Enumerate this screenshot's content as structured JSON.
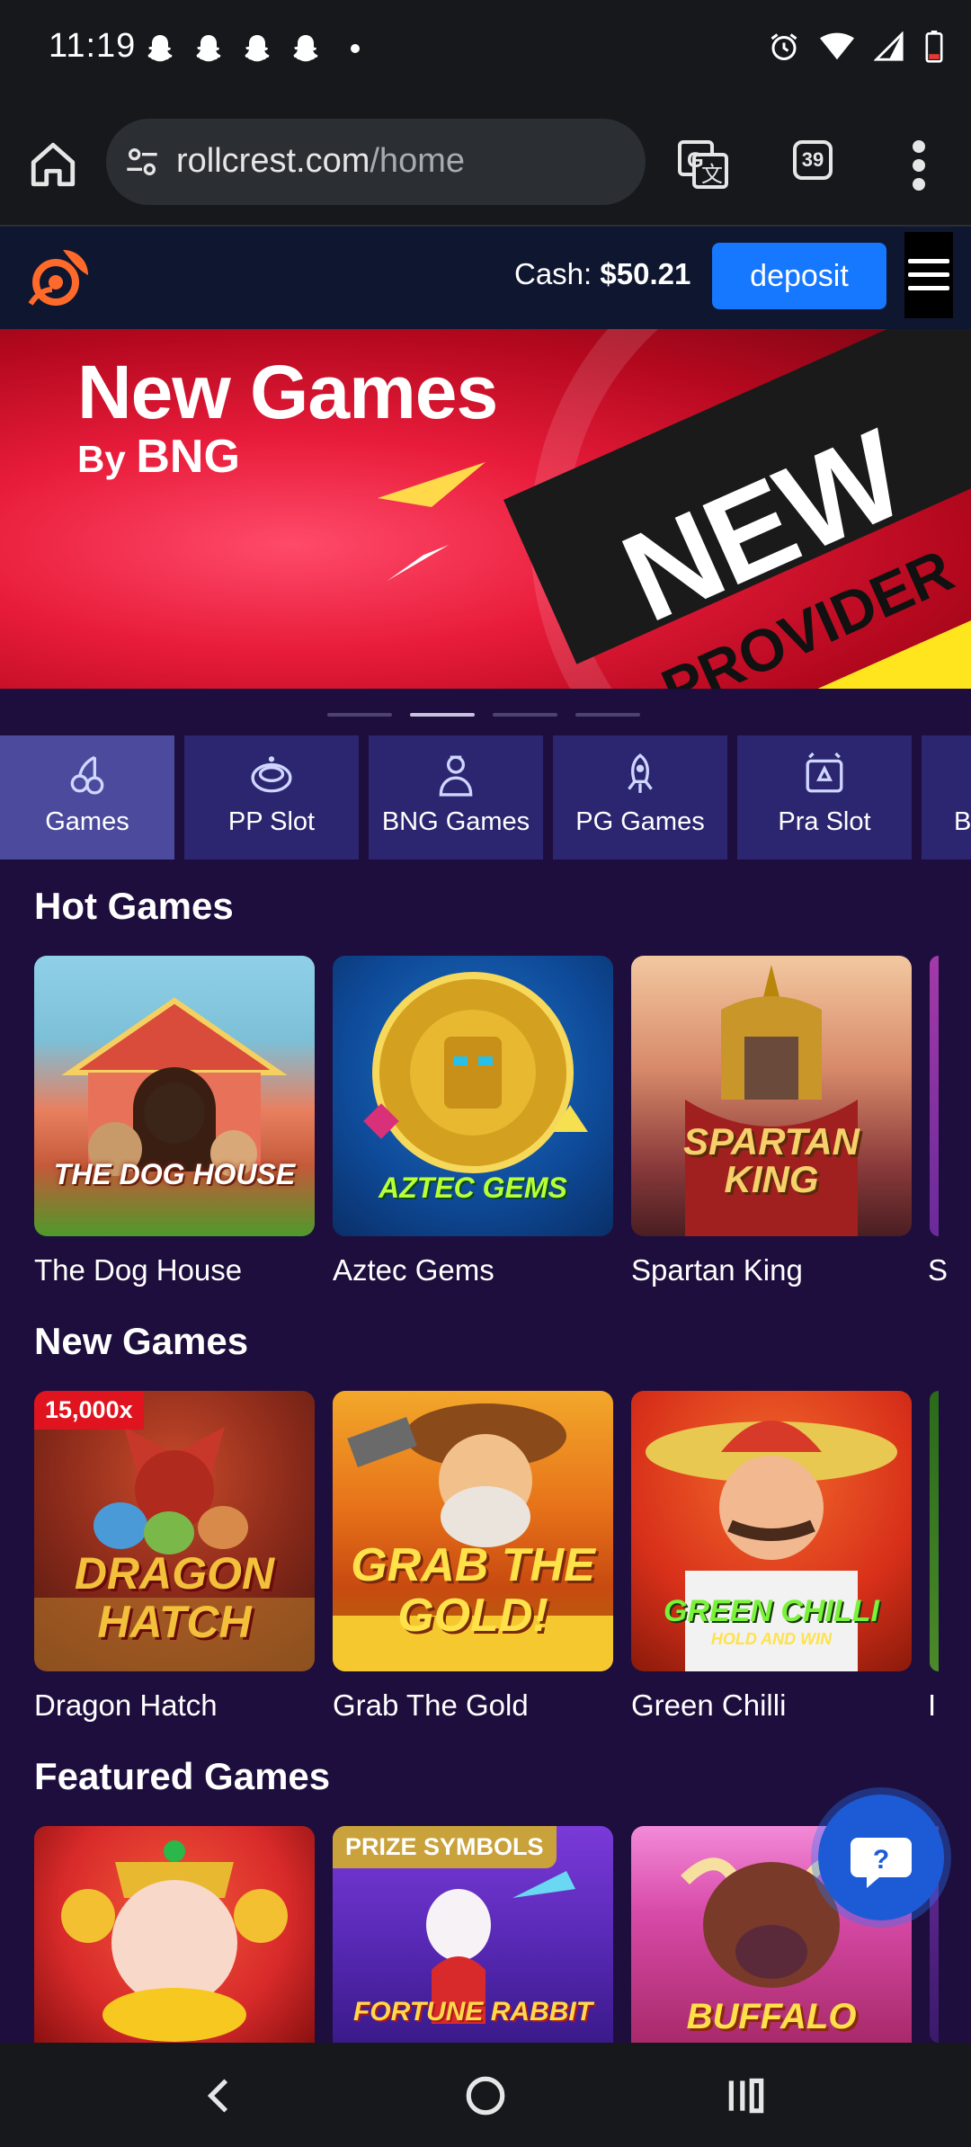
{
  "status_bar": {
    "time": "11:19",
    "notification_icons": [
      "snapchat-icon",
      "snapchat-icon",
      "snapchat-icon",
      "snapchat-icon"
    ],
    "system_icons": [
      "alarm-icon",
      "wifi-icon",
      "signal-icon",
      "battery-icon"
    ]
  },
  "browser": {
    "url_domain": "rollcrest.com",
    "url_path": "/home",
    "tab_count": "39"
  },
  "site_header": {
    "cash_label": "Cash:",
    "cash_value": "$50.21",
    "deposit_label": "deposit"
  },
  "banner": {
    "title": "New Games",
    "subtitle_prefix": "By",
    "subtitle_brand": "BNG",
    "ribbon_text": "NEW",
    "ribbon_text_2": "PROVIDER",
    "slide_count": 4,
    "active_slide": 2
  },
  "categories": [
    {
      "label": "Games",
      "icon": "cherries-icon",
      "active": true
    },
    {
      "label": "PP Slot",
      "icon": "roulette-icon",
      "active": false
    },
    {
      "label": "BNG Games",
      "icon": "dealer-icon",
      "active": false
    },
    {
      "label": "PG Games",
      "icon": "rocket-icon",
      "active": false
    },
    {
      "label": "Pra Slot",
      "icon": "cards-icon",
      "active": false
    },
    {
      "label": "B",
      "icon": "",
      "active": false
    }
  ],
  "sections": {
    "hot": {
      "title": "Hot Games",
      "games": [
        {
          "name": "The Dog House",
          "art_text": "THE DOG HOUSE"
        },
        {
          "name": "Aztec Gems",
          "art_text": "AZTEC GEMS"
        },
        {
          "name": "Spartan King",
          "art_text": "SPARTAN KING"
        }
      ],
      "peek_name": "S"
    },
    "new": {
      "title": "New Games",
      "games": [
        {
          "name": "Dragon Hatch",
          "art_text": "DRAGON HATCH",
          "badge": "15,000x"
        },
        {
          "name": "Grab The Gold",
          "art_text": "GRAB THE GOLD!"
        },
        {
          "name": "Green Chilli",
          "art_text": "GREEN CHILLI",
          "art_sub": "HOLD AND WIN"
        }
      ],
      "peek_name": "I"
    },
    "featured": {
      "title": "Featured Games",
      "games": [
        {
          "name": "",
          "art_text": ""
        },
        {
          "name": "",
          "art_text": "FORTUNE RABBIT",
          "badge": "PRIZE SYMBOLS"
        },
        {
          "name": "",
          "art_text": "BUFFALO"
        }
      ]
    }
  },
  "colors": {
    "page_bg": "#1e0e3d",
    "header_bg": "#0f1630",
    "deposit_blue": "#1677ff",
    "category_bg": "#2c2670",
    "category_active_bg": "#4b4a9d"
  }
}
